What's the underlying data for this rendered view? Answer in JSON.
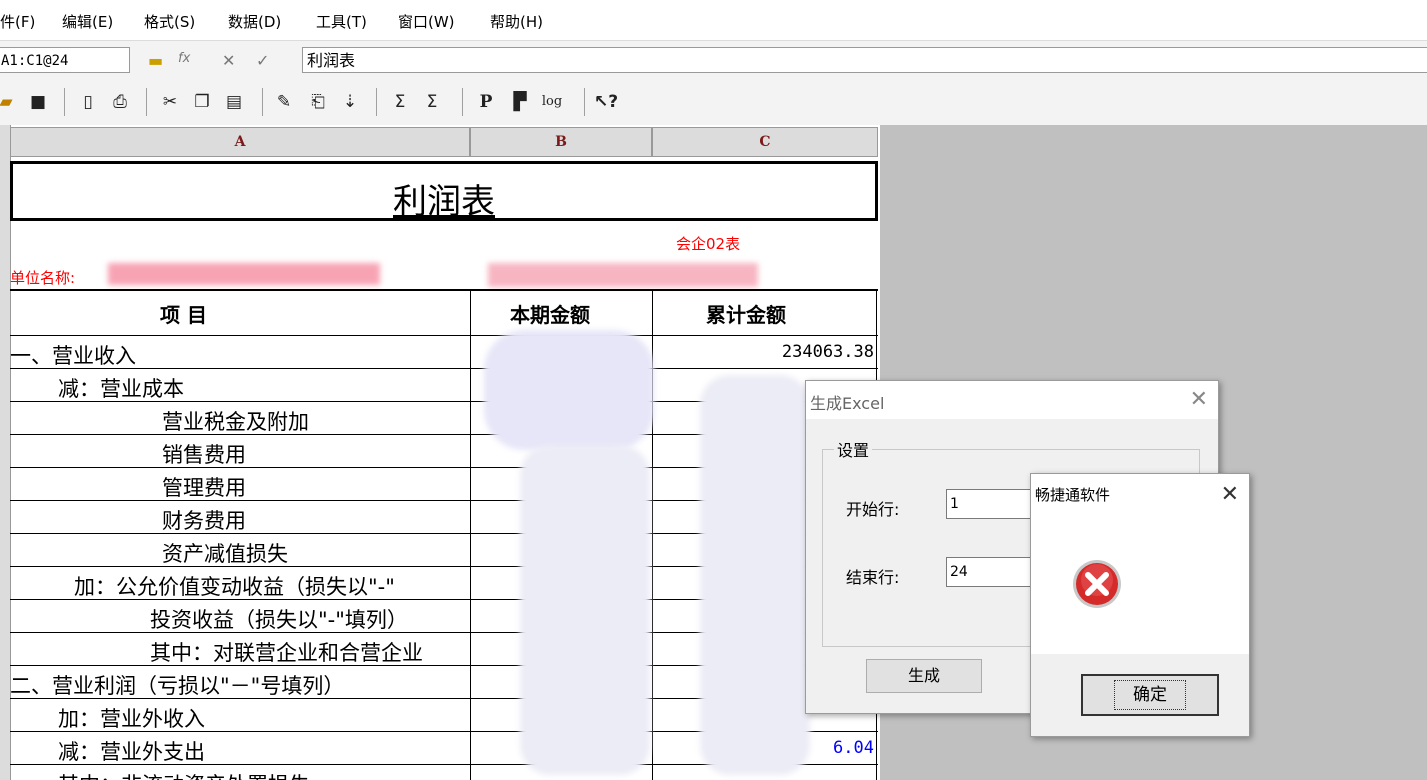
{
  "menu": [
    "件(F)",
    "编辑(E)",
    "格式(S)",
    "数据(D)",
    "工具(T)",
    "窗口(W)",
    "帮助(H)"
  ],
  "formula_bar": {
    "cell_ref": "A1:C1@24",
    "content": "利润表",
    "fx_label": "fx"
  },
  "toolbar": {
    "bold_p": "P",
    "log": "log",
    "help": "?"
  },
  "sheet": {
    "columns": [
      "A",
      "B",
      "C"
    ],
    "title": "利润表",
    "form_code": "会企02表",
    "unit_label": "单位名称:",
    "headers": {
      "item": "项          目",
      "current": "本期金额",
      "cumulative": "累计金额"
    },
    "rows": [
      {
        "label": "一、营业收入",
        "cumulative": "234063.38"
      },
      {
        "label": "减：营业成本",
        "cumulative": ""
      },
      {
        "label": "营业税金及附加",
        "cumulative": ""
      },
      {
        "label": "销售费用",
        "cumulative": ""
      },
      {
        "label": "管理费用",
        "cumulative": ""
      },
      {
        "label": "财务费用",
        "cumulative": ""
      },
      {
        "label": "资产减值损失",
        "cumulative": ""
      },
      {
        "label": "加：公允价值变动收益（损失以\"-\"",
        "cumulative": ""
      },
      {
        "label": "投资收益（损失以\"-\"填列）",
        "cumulative": ""
      },
      {
        "label": "其中：对联营企业和合营企业",
        "cumulative": ""
      },
      {
        "label": "二、营业利润（亏损以\"－\"号填列）",
        "cumulative": ""
      },
      {
        "label": "加：营业外收入",
        "cumulative": ""
      },
      {
        "label": "减：营业外支出",
        "cumulative": "6.04"
      },
      {
        "label": "其中：非流动资产处置损失",
        "cumulative": ""
      }
    ]
  },
  "excel_dialog": {
    "title": "生成Excel",
    "group": "设置",
    "start_label": "开始行:",
    "start_value": "1",
    "end_label": "结束行:",
    "end_value": "24",
    "generate": "生成"
  },
  "error_dialog": {
    "title": "畅捷通软件",
    "ok": "确定"
  },
  "colors": {
    "red_text": "#ff0000",
    "blue_value": "#0000ff",
    "workspace": "#c0c0c0"
  }
}
